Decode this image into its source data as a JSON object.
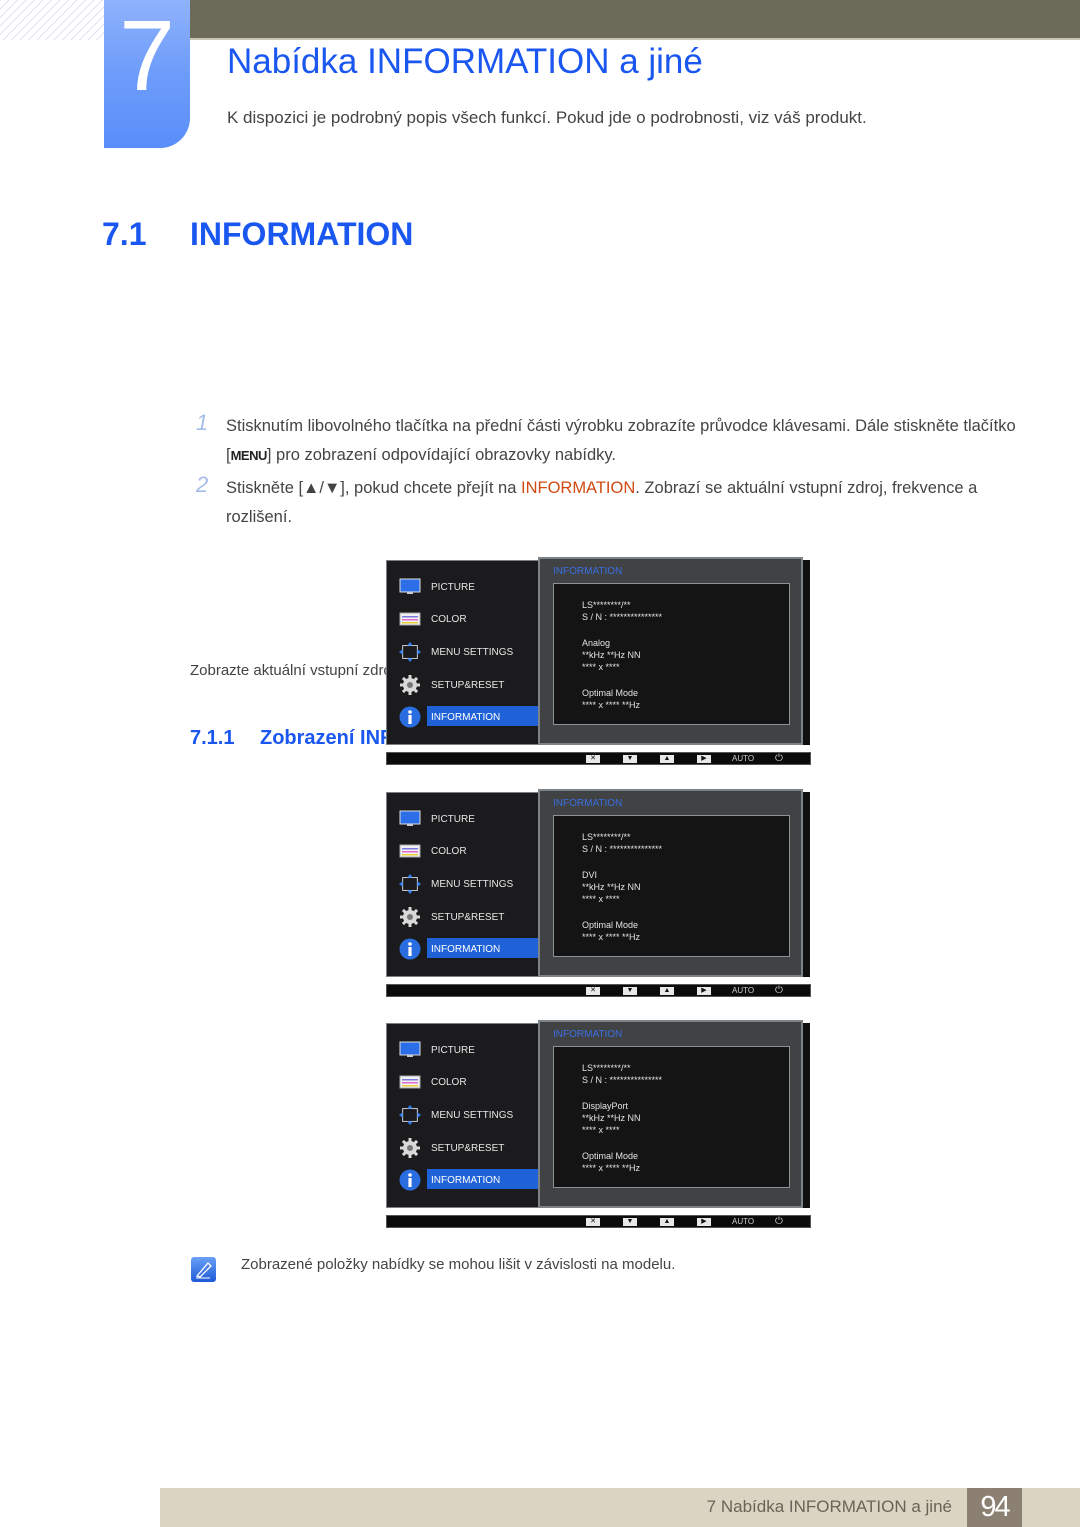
{
  "header": {
    "chapter_number": "7",
    "chapter_title": "Nabídka INFORMATION a jiné",
    "chapter_intro": "K dispozici je podrobný popis všech funkcí. Pokud jde o podrobnosti, viz váš produkt."
  },
  "section": {
    "number": "7.1",
    "title": "INFORMATION",
    "description": "Zobrazte aktuální vstupní zdroj, frekvenci a rozlišení."
  },
  "subsection": {
    "number": "7.1.1",
    "title": "Zobrazení INFORMATION"
  },
  "steps": [
    {
      "number": "1",
      "text_before": "Stisknutím libovolného tlačítka na přední části výrobku zobrazíte průvodce klávesami. Dále stiskněte tlačítko [",
      "key": "MENU",
      "text_after": "] pro zobrazení odpovídající obrazovky nabídky."
    },
    {
      "number": "2",
      "text_before": "Stiskněte [▲/▼], pokud chcete přejít na ",
      "highlight": "INFORMATION",
      "text_after": ". Zobrazí se aktuální vstupní zdroj, frekvence a rozlišení."
    }
  ],
  "osd_menu": {
    "items": [
      {
        "label": "PICTURE",
        "icon": "monitor-icon"
      },
      {
        "label": "COLOR",
        "icon": "color-palette-icon"
      },
      {
        "label": "MENU SETTINGS",
        "icon": "arrows-move-icon"
      },
      {
        "label": "SETUP&RESET",
        "icon": "gear-icon"
      },
      {
        "label": "INFORMATION",
        "icon": "info-icon",
        "active": true
      }
    ],
    "panel_title": "INFORMATION",
    "keys": {
      "close": "✕",
      "down": "▼",
      "up": "▲",
      "right": "▶",
      "auto": "AUTO",
      "power": "⏻"
    },
    "screens": [
      {
        "model": "LS********/**",
        "serial": "S / N : ***************",
        "source": "Analog",
        "frequency": "**kHz **Hz NN",
        "resolution": "**** x ****",
        "optimal_label": "Optimal Mode",
        "optimal_value": "**** x **** **Hz"
      },
      {
        "model": "LS********/**",
        "serial": "S / N : ***************",
        "source": "DVI",
        "frequency": "**kHz **Hz NN",
        "resolution": "**** x ****",
        "optimal_label": "Optimal Mode",
        "optimal_value": "**** x **** **Hz"
      },
      {
        "model": "LS********/**",
        "serial": "S / N : ***************",
        "source": "DisplayPort",
        "frequency": "**kHz **Hz NN",
        "resolution": "**** x ****",
        "optimal_label": "Optimal Mode",
        "optimal_value": "**** x **** **Hz"
      }
    ]
  },
  "note": {
    "text": "Zobrazené položky nabídky se mohou lišit v závislosti na modelu."
  },
  "footer": {
    "title": "7 Nabídka INFORMATION a jiné",
    "page": "94"
  },
  "colors": {
    "heading_blue": "#1a56f0",
    "highlight_orange": "#d04a12",
    "top_bar": "#6c6b5a",
    "footer_bg": "#dad4c3",
    "footer_page_bg": "#8c8073",
    "osd_active": "#1f62d8"
  }
}
